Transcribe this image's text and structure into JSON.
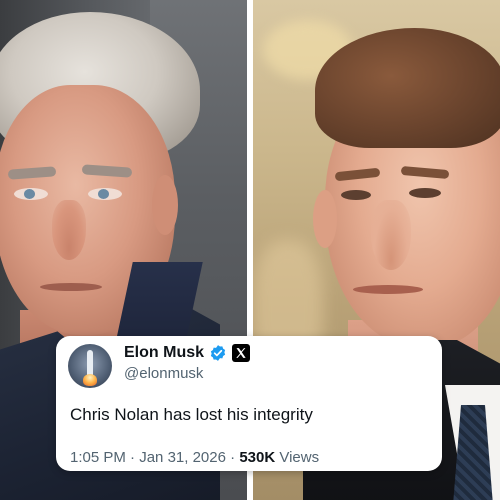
{
  "tweet": {
    "display_name": "Elon Musk",
    "handle": "@elonmusk",
    "text": "Chris Nolan has lost his integrity",
    "time": "1:05 PM",
    "separator": "·",
    "date": "Jan 31, 2026",
    "views_count": "530K",
    "views_label": "Views"
  },
  "icons": {
    "verified": "verified-badge-icon",
    "platform": "x-logo-icon",
    "avatar": "rocket-avatar"
  },
  "colors": {
    "verified_blue": "#1d9bf0",
    "text_primary": "#0f1419",
    "text_secondary": "#536471",
    "card_bg": "#ffffff"
  }
}
